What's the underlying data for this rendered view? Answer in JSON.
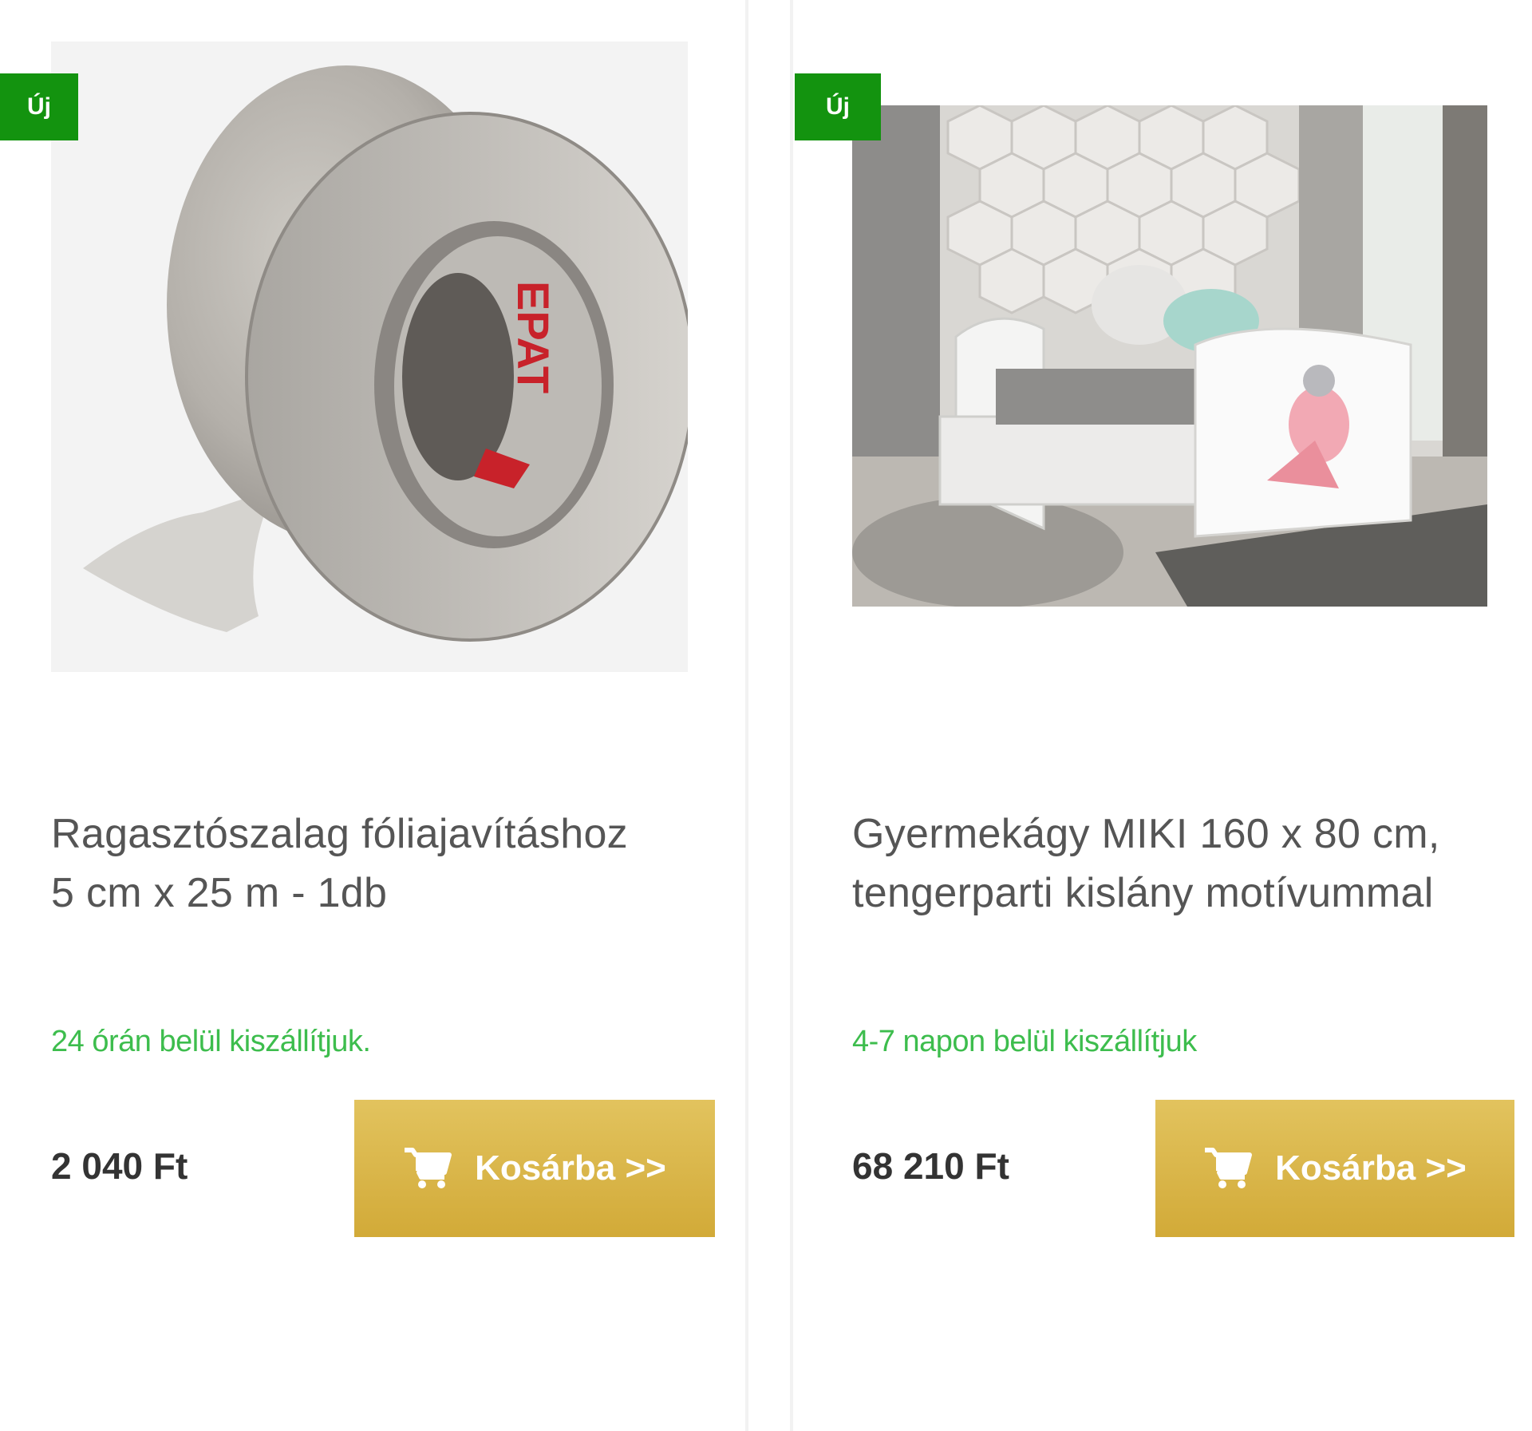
{
  "products": [
    {
      "badge": "Új",
      "title_line1": "Ragasztószalag fóliajavításhoz",
      "title_line2": "5 cm x 25 m - 1db",
      "delivery": "24 órán belül kiszállítjuk.",
      "price": "2 040 Ft",
      "button_label": "Kosárba >>",
      "image_logo_text": "EPAT"
    },
    {
      "badge": "Új",
      "title_line1": "Gyermekágy MIKI 160 x 80 cm,",
      "title_line2": "tengerparti kislány motívummal",
      "delivery": "4-7 napon belül kiszállítjuk",
      "price": "68 210 Ft",
      "button_label": "Kosárba >>"
    }
  ],
  "icons": {
    "cart": "shopping-cart-icon"
  },
  "colors": {
    "badge": "#13930f",
    "delivery": "#3dbd4d",
    "button": "#d9b44a",
    "price": "#333333"
  }
}
